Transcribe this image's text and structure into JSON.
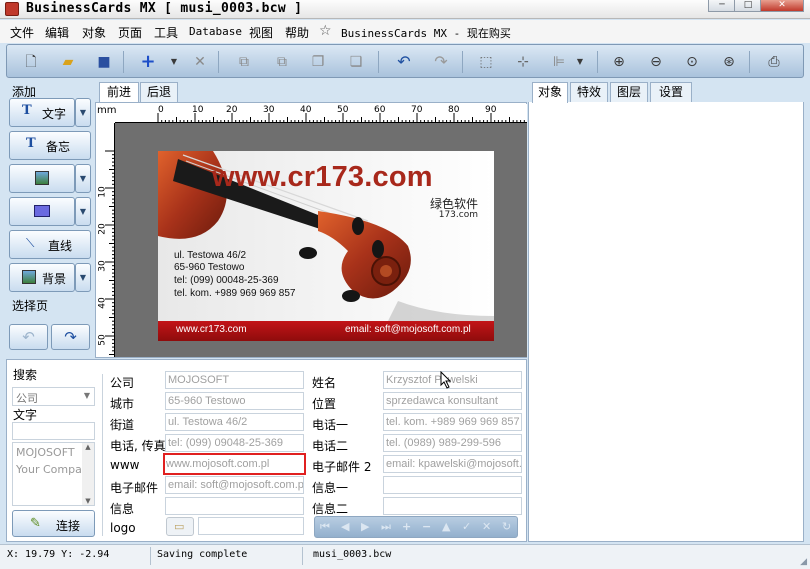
{
  "window": {
    "title": "BusinessCards MX [ musi_0003.bcw ]",
    "buttons": [
      "─",
      "□",
      "✕"
    ]
  },
  "menu": {
    "items": [
      "文件",
      "编辑",
      "对象",
      "页面",
      "工具",
      "Database",
      "视图",
      "帮助"
    ],
    "promo": "BusinessCards MX - 现在购买"
  },
  "toolbar": {
    "icons": [
      "new-file-icon",
      "open-folder-icon",
      "save-icon",
      "add-icon",
      "delete-icon",
      "group-icon",
      "ungroup-icon",
      "bring-front-icon",
      "send-back-icon",
      "undo-icon",
      "redo-icon",
      "align-grid-icon",
      "align-nodes-icon",
      "align-left-icon",
      "zoom-in-icon",
      "zoom-out-icon",
      "zoom-fit-icon",
      "zoom-actual-icon",
      "print-preview-icon"
    ]
  },
  "left": {
    "add_header": "添加",
    "text_button": "文字",
    "memo_button": "备忘",
    "line_button": "直线",
    "background_button": "背景",
    "select_page_header": "选择页"
  },
  "design_tabs": [
    "前进",
    "后退"
  ],
  "ruler": {
    "unit": "mm",
    "h_ticks": [
      "0",
      "10",
      "20",
      "30",
      "40",
      "50",
      "60",
      "70",
      "80",
      "90"
    ],
    "v_ticks": [
      "10",
      "20",
      "30",
      "40",
      "50"
    ]
  },
  "card": {
    "headline": "www.cr173.com",
    "brand": "绿色软件",
    "domain": "173.com",
    "address_lines": [
      "ul. Testowa 46/2",
      "65-960 Testowo",
      "tel: (099) 00048-25-369",
      "tel. kom. +989 969 969 857"
    ],
    "footer_left": "www.cr173.com",
    "footer_right": "email: soft@mojosoft.com.pl"
  },
  "right_tabs": [
    "对象",
    "特效",
    "图层",
    "设置"
  ],
  "search": {
    "header": "搜索",
    "field_select": "公司",
    "text_label": "文字",
    "results": [
      "MOJOSOFT",
      "Your Compa"
    ],
    "connect_button": "连接"
  },
  "form": {
    "left": [
      {
        "label": "公司",
        "value": "MOJOSOFT"
      },
      {
        "label": "城市",
        "value": "65-960 Testowo"
      },
      {
        "label": "街道",
        "value": "ul. Testowa 46/2"
      },
      {
        "label": "电话, 传真",
        "value": "tel: (099) 09048-25-369"
      },
      {
        "label": "www",
        "value": "www.mojosoft.com.pl"
      },
      {
        "label": "电子邮件",
        "value": "email: soft@mojosoft.com.pl"
      },
      {
        "label": "信息",
        "value": ""
      },
      {
        "label": "logo",
        "value": ""
      }
    ],
    "right": [
      {
        "label": "姓名",
        "value": "Krzysztof Pawelski"
      },
      {
        "label": "位置",
        "value": "sprzedawca konsultant"
      },
      {
        "label": "电话一",
        "value": "tel. kom. +989 969 969 857"
      },
      {
        "label": "电话二",
        "value": "tel. (0989) 989-299-596"
      },
      {
        "label": "电子邮件 2",
        "value": "email: kpawelski@mojosoft.c"
      },
      {
        "label": "信息一",
        "value": ""
      },
      {
        "label": "信息二",
        "value": ""
      }
    ]
  },
  "status": {
    "coords": "X: 19.79 Y: -2.94",
    "message": "Saving complete",
    "file": "musi_0003.bcw"
  },
  "colors": {
    "headline": "#a8281b",
    "footer_bar": "#b01014",
    "highlight_border": "#e02020",
    "toolbar_bg": "#a9c2dc"
  }
}
